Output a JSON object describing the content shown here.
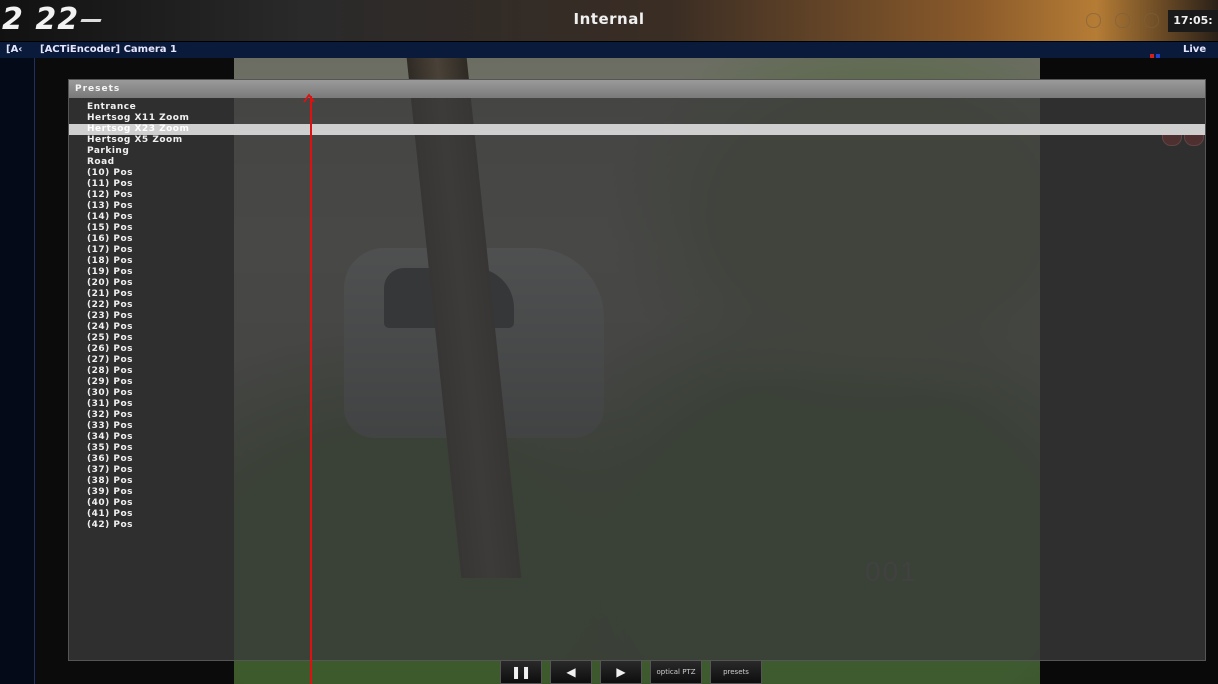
{
  "app": {
    "logo": "2 22",
    "title": "Internal",
    "clock": "17:05:"
  },
  "camera": {
    "tab_prefix": "[A‹",
    "name": "[ACTiEncoder] Camera 1",
    "mode": "Live"
  },
  "video": {
    "overlay_number": "001"
  },
  "presets": {
    "header": "Presets",
    "items": [
      "Entrance",
      "Hertsog X11 Zoom",
      "Hertsog X23 Zoom",
      "Hertsog X5 Zoom",
      "Parking",
      "Road",
      "(10) Pos",
      "(11) Pos",
      "(12) Pos",
      "(13) Pos",
      "(14) Pos",
      "(15) Pos",
      "(16) Pos",
      "(17) Pos",
      "(18) Pos",
      "(19) Pos",
      "(20) Pos",
      "(21) Pos",
      "(22) Pos",
      "(23) Pos",
      "(24) Pos",
      "(25) Pos",
      "(26) Pos",
      "(27) Pos",
      "(28) Pos",
      "(29) Pos",
      "(30) Pos",
      "(31) Pos",
      "(32) Pos",
      "(33) Pos",
      "(34) Pos",
      "(35) Pos",
      "(36) Pos",
      "(37) Pos",
      "(38) Pos",
      "(39) Pos",
      "(40) Pos",
      "(41) Pos",
      "(42) Pos"
    ],
    "selected_index": 2
  },
  "controls": {
    "pause": "❚❚",
    "prev": "◀",
    "next": "▶",
    "optical_ptz": "optical PTZ",
    "presets": "presets"
  },
  "colors": {
    "annotation": "#e01010",
    "selection": "#cfcfcf"
  }
}
